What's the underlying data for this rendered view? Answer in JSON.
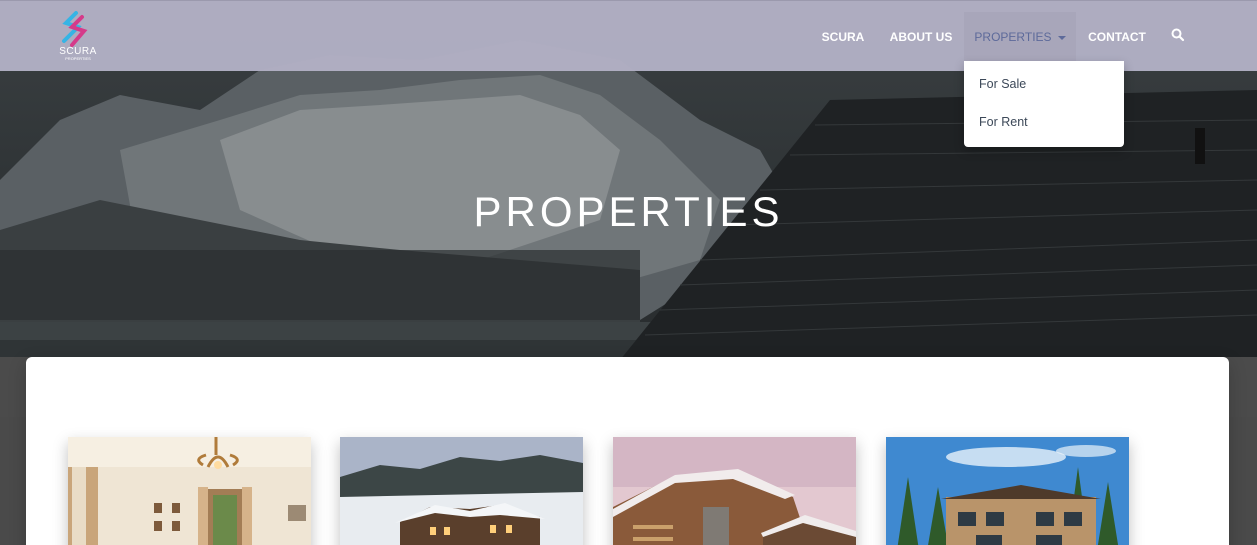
{
  "brand": {
    "logo_text": "SCURA",
    "logo_sub": "PROPERTIES"
  },
  "nav": {
    "items": [
      {
        "label": "SCURA"
      },
      {
        "label": "ABOUT US"
      },
      {
        "label": "PROPERTIES"
      },
      {
        "label": "CONTACT"
      }
    ],
    "search_icon": "search-icon"
  },
  "dropdown": {
    "items": [
      {
        "label": "For Sale"
      },
      {
        "label": "For Rent"
      }
    ]
  },
  "hero": {
    "title": "PROPERTIES"
  },
  "colors": {
    "navbar": "#b2b0c4",
    "nav_active_text": "#5d6a9a",
    "card": "#ffffff"
  }
}
